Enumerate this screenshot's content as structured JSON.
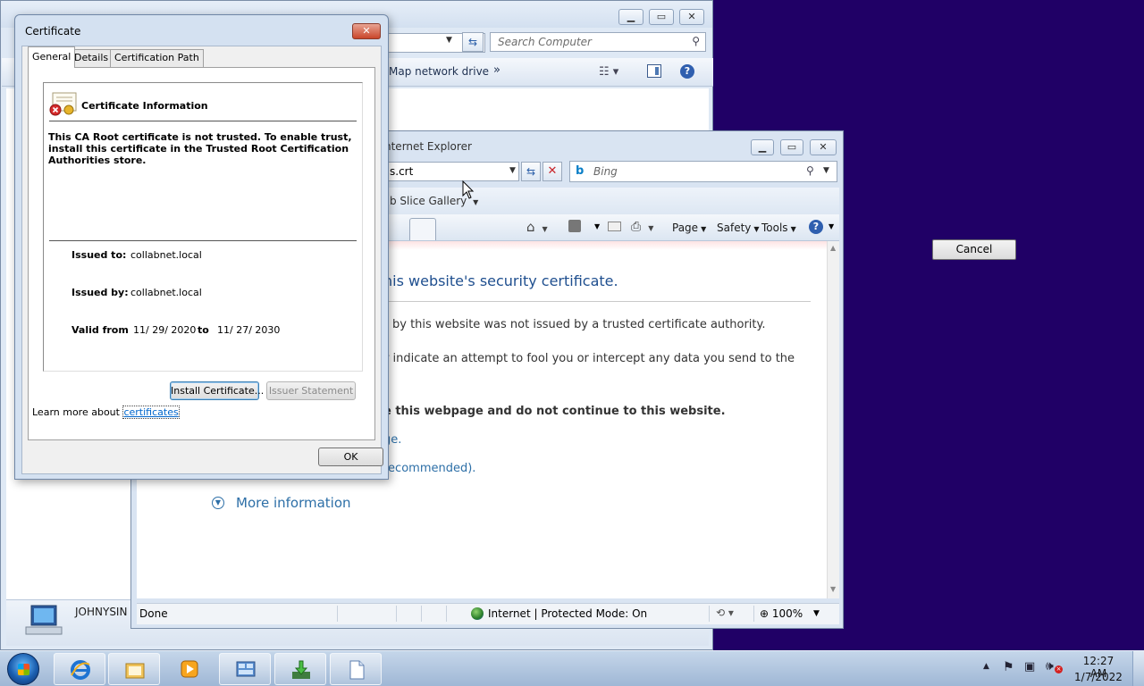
{
  "explorer": {
    "search_placeholder": "Search Computer",
    "toolbar_map_drive": "Map network drive",
    "toolbar_more": "»",
    "computer_name": "JOHNYSIN"
  },
  "ie": {
    "title": "nternet Explorer",
    "address": "s.crt",
    "search_placeholder": "Bing",
    "favorites_webslice": "b Slice Gallery",
    "commands": {
      "page": "Page",
      "safety": "Safety",
      "tools": "Tools"
    },
    "error": {
      "heading": "his website's security certificate.",
      "p1": "by this website was not issued by a trusted certificate authority.",
      "p2": "r indicate an attempt to fool you or intercept any data you send to the",
      "p3": "e this webpage and do not continue to this website.",
      "link1": "ge.",
      "link2": "recommended).",
      "more_info": "More information"
    },
    "status": {
      "text": "Done",
      "zone": "Internet | Protected Mode: On",
      "zoom": "100%"
    }
  },
  "certificate": {
    "window_title": "Certificate",
    "tabs": [
      {
        "label": "General"
      },
      {
        "label": "Details"
      },
      {
        "label": "Certification Path"
      }
    ],
    "info_title": "Certificate Information",
    "message": "This CA Root certificate is not trusted. To enable trust, install this certificate in the Trusted Root Certification Authorities store.",
    "issued_to_label": "Issued to:",
    "issued_to": "collabnet.local",
    "issued_by_label": "Issued by:",
    "issued_by": "collabnet.local",
    "valid_from_label": "Valid from",
    "valid_from": "11/ 29/ 2020",
    "valid_to_label": "to",
    "valid_to": "11/ 27/ 2030",
    "install_button": "Install Certificate...",
    "issuer_button": "Issuer Statement",
    "learn_prefix": "Learn more about ",
    "learn_link": "certificates",
    "ok_button": "OK"
  },
  "floating_cancel": "Cancel",
  "taskbar": {
    "time": "12:27 AM",
    "date": "1/7/2022"
  }
}
